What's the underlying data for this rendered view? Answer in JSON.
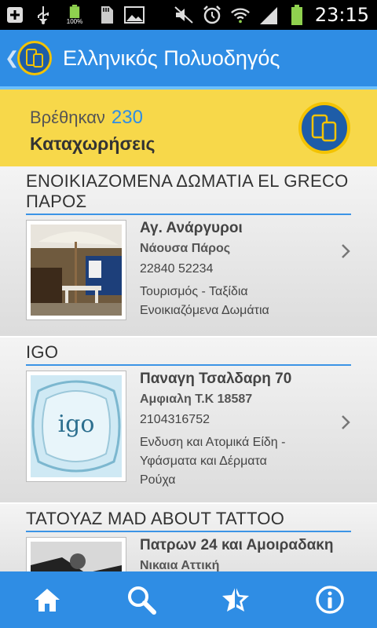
{
  "status_bar": {
    "time": "23:15",
    "battery_text": "100%"
  },
  "app_bar": {
    "back_label": "❮",
    "title": "Ελληνικός Πολυοδηγός"
  },
  "banner": {
    "found_label": "Βρέθηκαν",
    "count": "230",
    "entries_label": "Καταχωρήσεις"
  },
  "listings": [
    {
      "title": "ΕΝΟΙΚΙΑΖΟΜΕΝΑ ΔΩΜΑΤΙΑ EL GRECO ΠΑΡΟΣ",
      "address": "Αγ. Ανάργυροι",
      "city": "Νάουσα Πάρος",
      "phone": "22840 52234",
      "category": "Τουρισμός - Ταξίδια",
      "subcategory": "Ενοικιαζόμενα Δωμάτια"
    },
    {
      "title": "IGO",
      "address": "Παναγη Τσαλδαρη 70",
      "city": "Αμφιαλη Τ.Κ 18587",
      "phone": "2104316752",
      "category": "Ενδυση και Ατομικά Είδη - Υφάσματα και Δέρματα",
      "subcategory": "Ρούχα",
      "logo_text": "igo"
    },
    {
      "title": "ΤΑΤΟΥΑΖ MAD ABOUT TATTOO",
      "address": "Πατρων 24 και Αμοιραδακη",
      "city": "Νικαια Αττική"
    }
  ],
  "bottom_nav": [
    {
      "icon": "home-icon"
    },
    {
      "icon": "search-icon"
    },
    {
      "icon": "favorites-icon"
    },
    {
      "icon": "info-icon"
    }
  ],
  "colors": {
    "primary": "#2f8de4",
    "banner": "#f7d84a",
    "count": "#2f8de4",
    "logo_ring": "#f4c300"
  }
}
